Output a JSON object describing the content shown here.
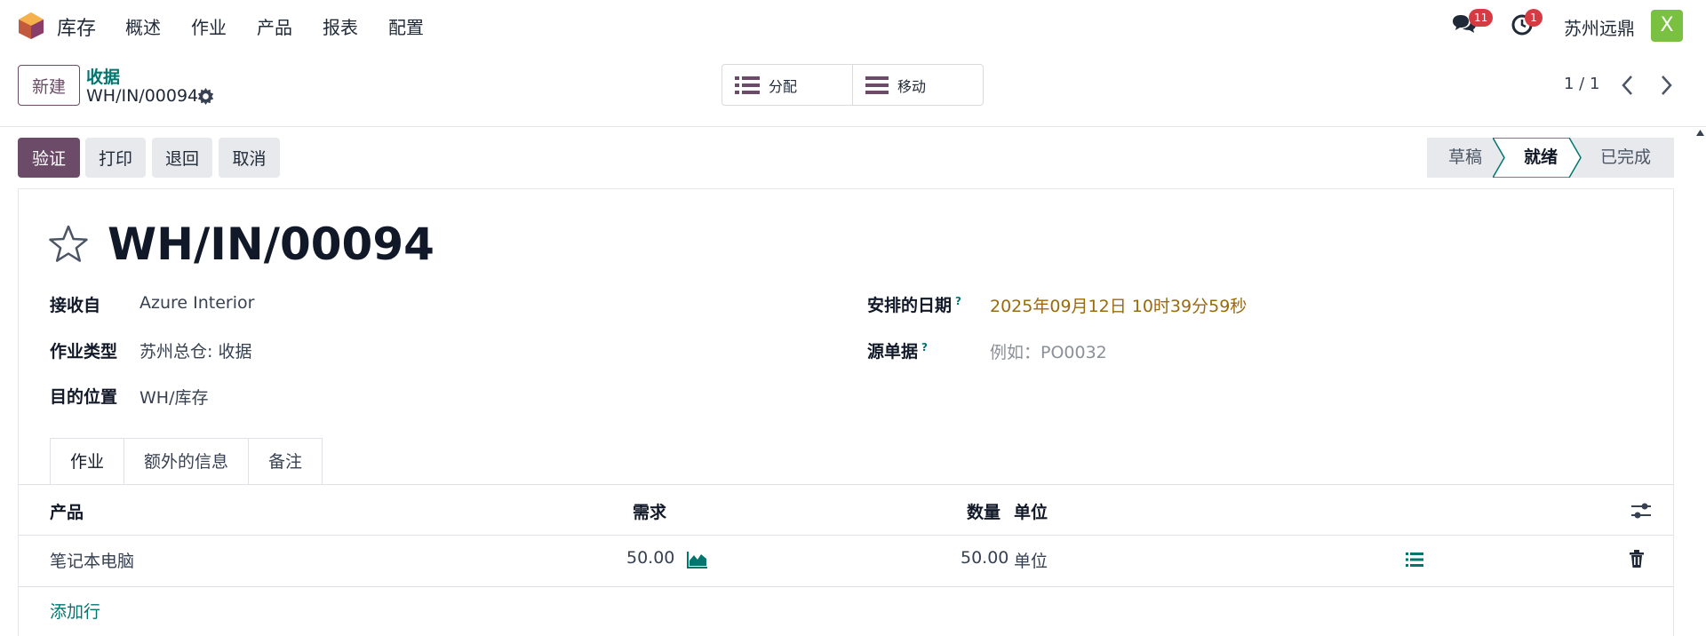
{
  "nav": {
    "app_name": "库存",
    "menu": [
      "概述",
      "作业",
      "产品",
      "报表",
      "配置"
    ],
    "chat_badge": "11",
    "activity_badge": "1",
    "company": "苏州远鼎",
    "avatar_letter": "X"
  },
  "control": {
    "new_label": "新建",
    "breadcrumb_parent": "收据",
    "breadcrumb_current": "WH/IN/00094",
    "smart_buttons": [
      "分配",
      "移动"
    ],
    "pager": "1 / 1"
  },
  "status": {
    "actions": [
      "验证",
      "打印",
      "退回",
      "取消"
    ],
    "stages": [
      "草稿",
      "就绪",
      "已完成"
    ],
    "active_stage": "就绪"
  },
  "record": {
    "title": "WH/IN/00094",
    "fields": {
      "partner_label": "接收自",
      "partner_value": "Azure Interior",
      "op_type_label": "作业类型",
      "op_type_value": "苏州总仓: 收据",
      "dest_label": "目的位置",
      "dest_value": "WH/库存",
      "scheduled_label": "安排的日期",
      "scheduled_value": "2025年09月12日 10时39分59秒",
      "origin_label": "源单据",
      "origin_placeholder": "例如：PO0032",
      "help_mark": "?"
    }
  },
  "tabs": [
    "作业",
    "额外的信息",
    "备注"
  ],
  "table": {
    "headers": {
      "product": "产品",
      "demand": "需求",
      "quantity": "数量",
      "uom": "单位"
    },
    "rows": [
      {
        "product": "笔记本电脑",
        "demand": "50.00",
        "quantity": "50.00",
        "uom": "单位"
      }
    ],
    "add_line": "添加行"
  },
  "colors": {
    "primary": "#6b4b67",
    "link": "#01766f",
    "badge": "#d63b43",
    "date": "#9a6a0c",
    "avatar": "#7ac142"
  }
}
